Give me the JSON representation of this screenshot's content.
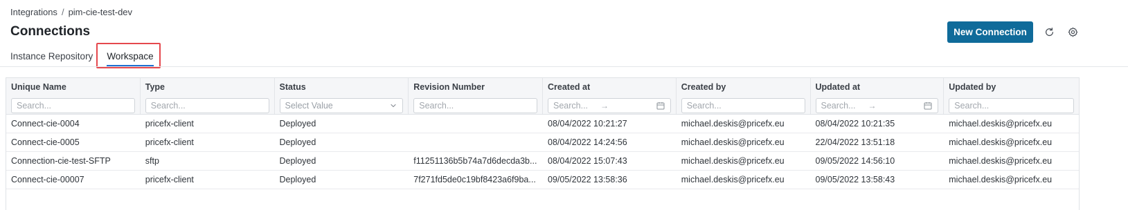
{
  "breadcrumb": {
    "root": "Integrations",
    "separator": "/",
    "current": "pim-cie-test-dev"
  },
  "page": {
    "title": "Connections"
  },
  "tabs": [
    {
      "label": "Instance Repository",
      "active": false
    },
    {
      "label": "Workspace",
      "active": true
    }
  ],
  "toolbar": {
    "new_connection_label": "New Connection",
    "refresh_icon": "refresh-icon",
    "settings_icon": "gear-icon"
  },
  "colors": {
    "primary": "#0f6b9a",
    "tab_underline": "#1f6fd1",
    "highlight": "#e5484d"
  },
  "table": {
    "columns": [
      {
        "label": "Unique Name",
        "filter_type": "text",
        "placeholder": "Search..."
      },
      {
        "label": "Type",
        "filter_type": "text",
        "placeholder": "Search..."
      },
      {
        "label": "Status",
        "filter_type": "select",
        "placeholder": "Select Value"
      },
      {
        "label": "Revision Number",
        "filter_type": "text",
        "placeholder": "Search..."
      },
      {
        "label": "Created at",
        "filter_type": "daterange",
        "placeholder": "Search..."
      },
      {
        "label": "Created by",
        "filter_type": "text",
        "placeholder": "Search..."
      },
      {
        "label": "Updated at",
        "filter_type": "daterange",
        "placeholder": "Search..."
      },
      {
        "label": "Updated by",
        "filter_type": "text",
        "placeholder": "Search..."
      }
    ],
    "rows": [
      [
        "Connect-cie-0004",
        "pricefx-client",
        "Deployed",
        "",
        "08/04/2022 10:21:27",
        "michael.deskis@pricefx.eu",
        "08/04/2022 10:21:35",
        "michael.deskis@pricefx.eu"
      ],
      [
        "Connect-cie-0005",
        "pricefx-client",
        "Deployed",
        "",
        "08/04/2022 14:24:56",
        "michael.deskis@pricefx.eu",
        "22/04/2022 13:51:18",
        "michael.deskis@pricefx.eu"
      ],
      [
        "Connection-cie-test-SFTP",
        "sftp",
        "Deployed",
        "f11251136b5b74a7d6decda3b...",
        "08/04/2022 15:07:43",
        "michael.deskis@pricefx.eu",
        "09/05/2022 14:56:10",
        "michael.deskis@pricefx.eu"
      ],
      [
        "Connect-cie-00007",
        "pricefx-client",
        "Deployed",
        "7f271fd5de0c19bf8423a6f9ba...",
        "09/05/2022 13:58:36",
        "michael.deskis@pricefx.eu",
        "09/05/2022 13:58:43",
        "michael.deskis@pricefx.eu"
      ]
    ]
  }
}
